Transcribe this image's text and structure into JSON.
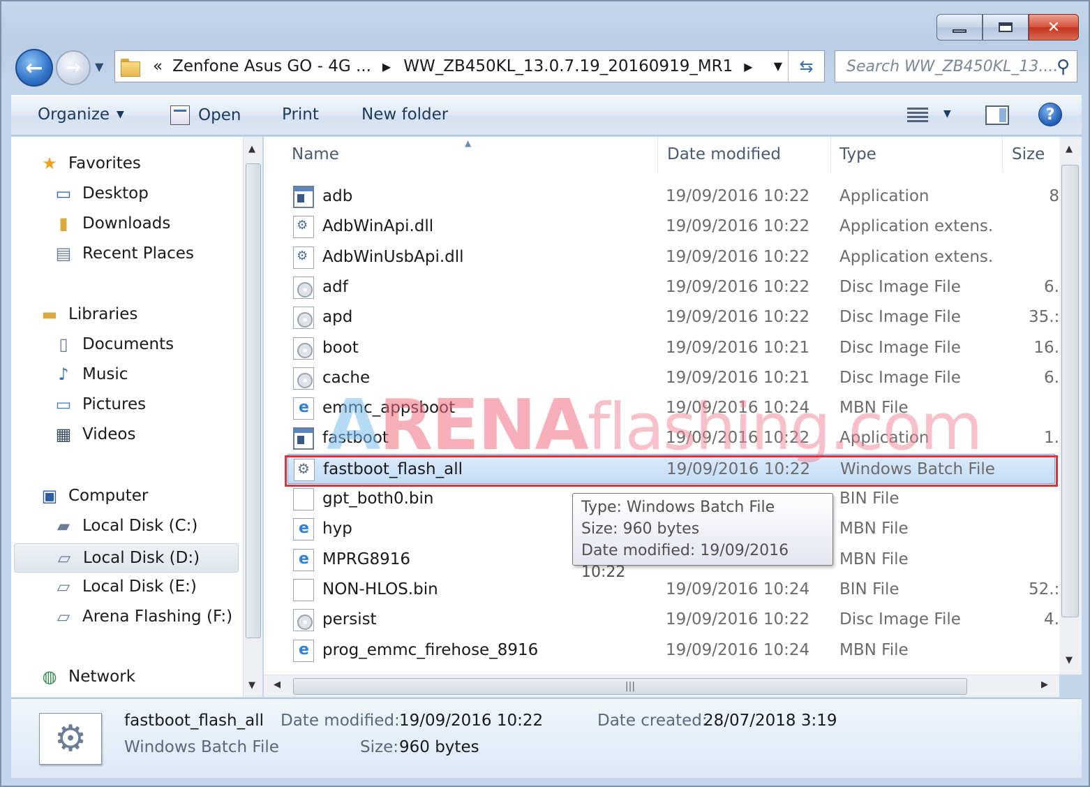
{
  "window": {
    "caption_buttons": [
      "minimize",
      "maximize",
      "close"
    ]
  },
  "address_bar": {
    "segments": [
      "«",
      "Zenfone Asus GO - 4G ...",
      "WW_ZB450KL_13.0.7.19_20160919_MR1"
    ]
  },
  "search": {
    "placeholder": "Search WW_ZB450KL_13...."
  },
  "toolbar": {
    "organize": "Organize",
    "open": "Open",
    "print": "Print",
    "new_folder": "New folder"
  },
  "nav": {
    "favorites": "Favorites",
    "desktop": "Desktop",
    "downloads": "Downloads",
    "recent": "Recent Places",
    "libraries": "Libraries",
    "documents": "Documents",
    "music": "Music",
    "pictures": "Pictures",
    "videos": "Videos",
    "computer": "Computer",
    "disk_c": "Local Disk (C:)",
    "disk_d": "Local Disk (D:)",
    "disk_e": "Local Disk (E:)",
    "disk_f": "Arena Flashing (F:)",
    "network": "Network"
  },
  "columns": {
    "name": "Name",
    "date": "Date modified",
    "type": "Type",
    "size": "Size"
  },
  "files": [
    {
      "name": "adb",
      "date": "19/09/2016 10:22",
      "type": "Application",
      "size": "8",
      "icon": "app-icon"
    },
    {
      "name": "AdbWinApi.dll",
      "date": "19/09/2016 10:22",
      "type": "Application extens...",
      "size": "",
      "icon": "dll-icon"
    },
    {
      "name": "AdbWinUsbApi.dll",
      "date": "19/09/2016 10:22",
      "type": "Application extens...",
      "size": "",
      "icon": "dll-icon"
    },
    {
      "name": "adf",
      "date": "19/09/2016 10:22",
      "type": "Disc Image File",
      "size": "6.",
      "icon": "disc-image-icon"
    },
    {
      "name": "apd",
      "date": "19/09/2016 10:22",
      "type": "Disc Image File",
      "size": "35.:",
      "icon": "disc-image-icon"
    },
    {
      "name": "boot",
      "date": "19/09/2016 10:21",
      "type": "Disc Image File",
      "size": "16.",
      "icon": "disc-image-icon"
    },
    {
      "name": "cache",
      "date": "19/09/2016 10:21",
      "type": "Disc Image File",
      "size": "6.",
      "icon": "disc-image-icon"
    },
    {
      "name": "emmc_appsboot",
      "date": "19/09/2016 10:24",
      "type": "MBN File",
      "size": "",
      "icon": "mbn-icon"
    },
    {
      "name": "fastboot",
      "date": "19/09/2016 10:22",
      "type": "Application",
      "size": "1.",
      "icon": "app-icon"
    },
    {
      "name": "fastboot_flash_all",
      "date": "19/09/2016 10:22",
      "type": "Windows Batch File",
      "size": "",
      "icon": "batch-file-icon"
    },
    {
      "name": "gpt_both0.bin",
      "date": "",
      "type": "BIN File",
      "size": "",
      "icon": "bin-file-icon"
    },
    {
      "name": "hyp",
      "date": "",
      "type": "MBN File",
      "size": "",
      "icon": "mbn-icon"
    },
    {
      "name": "MPRG8916",
      "date": "",
      "type": "MBN File",
      "size": "",
      "icon": "mbn-icon"
    },
    {
      "name": "NON-HLOS.bin",
      "date": "19/09/2016 10:24",
      "type": "BIN File",
      "size": "52.:",
      "icon": "bin-file-icon"
    },
    {
      "name": "persist",
      "date": "19/09/2016 10:22",
      "type": "Disc Image File",
      "size": "4.",
      "icon": "disc-image-icon"
    },
    {
      "name": "prog_emmc_firehose_8916",
      "date": "19/09/2016 10:24",
      "type": "MBN File",
      "size": "",
      "icon": "mbn-icon"
    }
  ],
  "selected_file": "fastboot_flash_all",
  "highlight_color": "#e0303a",
  "watermark": {
    "part1": "A",
    "part2": "RENA",
    "part3": "flashing.com"
  },
  "tooltip": {
    "line1": "Type: Windows Batch File",
    "line2": "Size: 960 bytes",
    "line3": "Date modified: 19/09/2016 10:22"
  },
  "details": {
    "name": "fastboot_flash_all",
    "type": "Windows Batch File",
    "date_modified_label": "Date modified:",
    "date_modified": "19/09/2016 10:22",
    "size_label": "Size:",
    "size": "960 bytes",
    "date_created_label": "Date created:",
    "date_created": "28/07/2018 3:19"
  }
}
